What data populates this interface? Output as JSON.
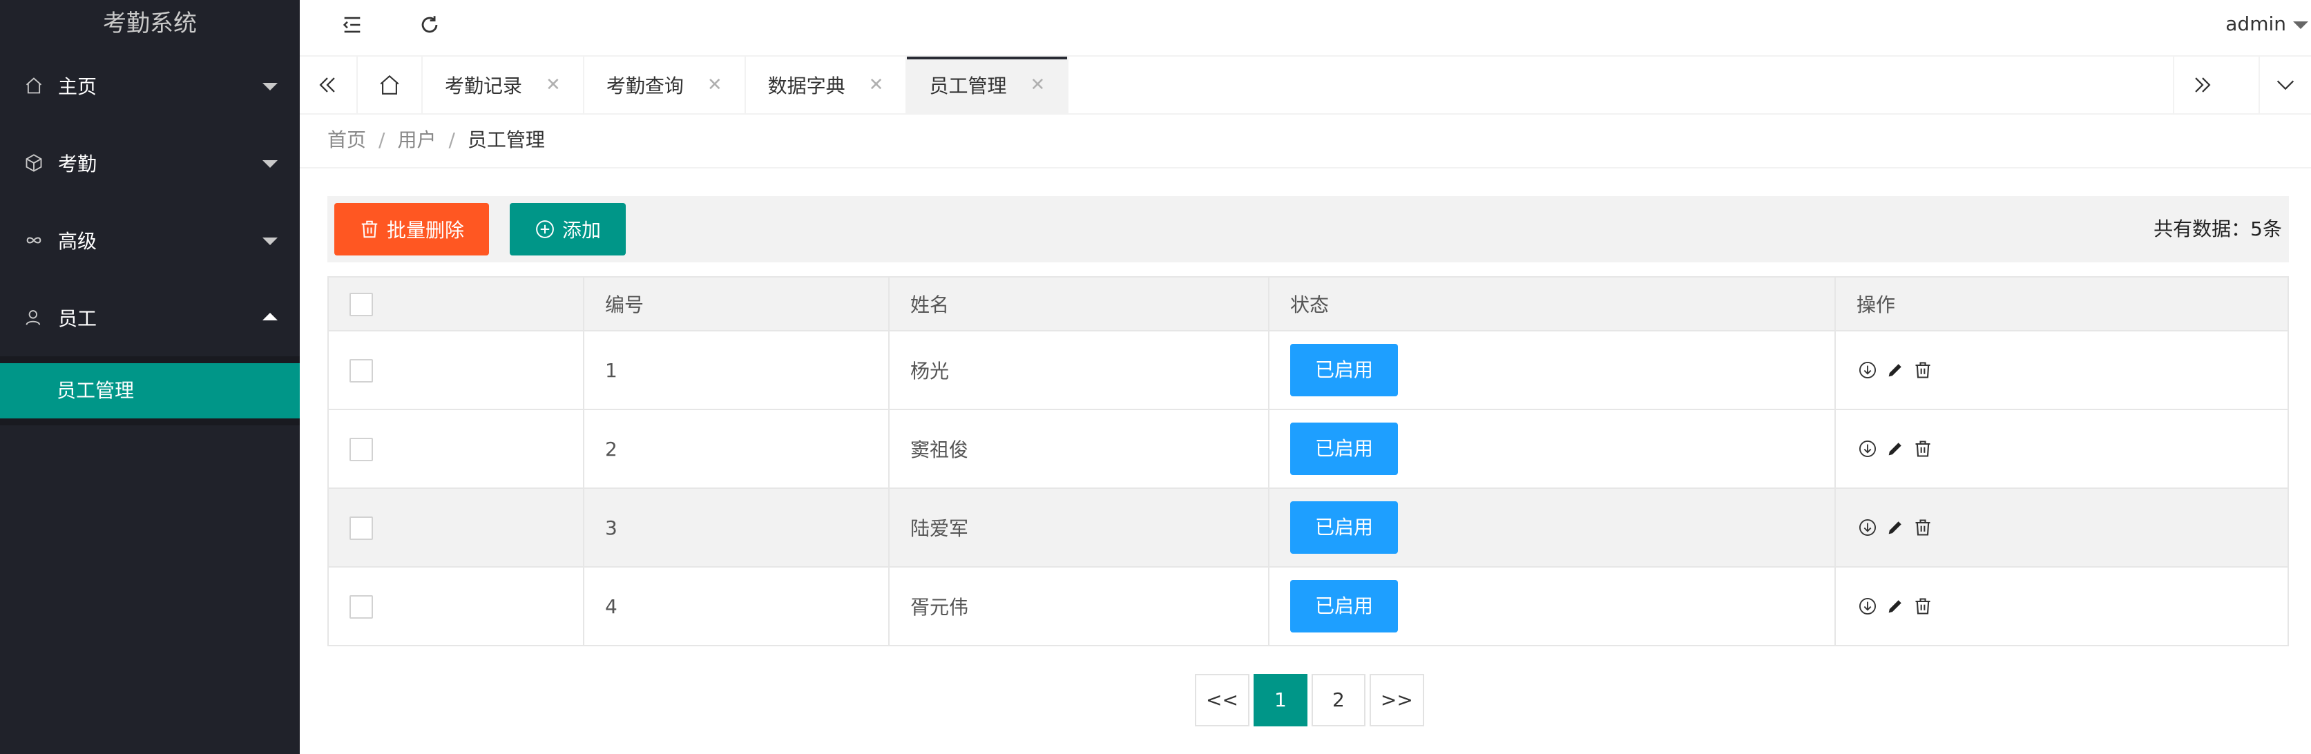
{
  "app": {
    "title": "考勤系统"
  },
  "sidebar": {
    "items": [
      {
        "label": "主页",
        "icon": "home-icon",
        "expanded": false
      },
      {
        "label": "考勤",
        "icon": "cube-icon",
        "expanded": false
      },
      {
        "label": "高级",
        "icon": "infinity-icon",
        "expanded": false
      },
      {
        "label": "员工",
        "icon": "user-icon",
        "expanded": true
      }
    ],
    "submenu": [
      {
        "label": "员工管理",
        "active": true
      }
    ]
  },
  "header": {
    "user": "admin"
  },
  "tabs": [
    {
      "label": "考勤记录",
      "active": false
    },
    {
      "label": "考勤查询",
      "active": false
    },
    {
      "label": "数据字典",
      "active": false
    },
    {
      "label": "员工管理",
      "active": true
    }
  ],
  "breadcrumb": [
    "首页",
    "用户",
    "员工管理"
  ],
  "toolbar": {
    "batch_delete": "批量删除",
    "add": "添加",
    "total": "共有数据：5条"
  },
  "table": {
    "columns": [
      "编号",
      "姓名",
      "状态",
      "操作"
    ],
    "rows": [
      {
        "id": "1",
        "name": "杨光",
        "status": "已启用"
      },
      {
        "id": "2",
        "name": "窦祖俊",
        "status": "已启用"
      },
      {
        "id": "3",
        "name": "陆爱军",
        "status": "已启用"
      },
      {
        "id": "4",
        "name": "胥元伟",
        "status": "已启用"
      }
    ]
  },
  "pagination": {
    "prev": "<<",
    "pages": [
      "1",
      "2"
    ],
    "current": "1",
    "next": ">>"
  },
  "colors": {
    "sidebar_bg": "#20222a",
    "accent": "#009688",
    "danger": "#ff5722",
    "status": "#1e9fff"
  }
}
